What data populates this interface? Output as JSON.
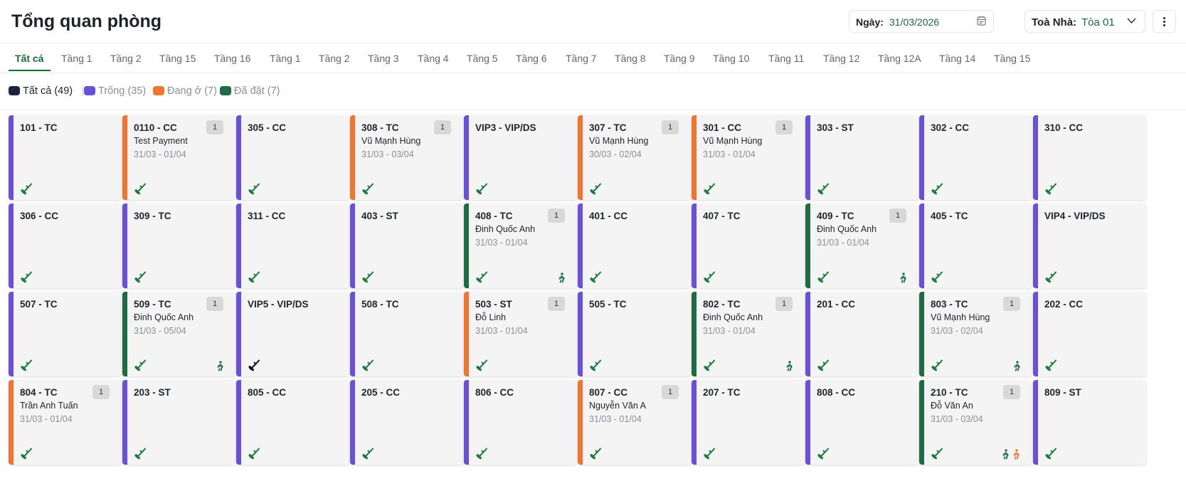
{
  "header": {
    "title": "Tổng quan phòng",
    "date_label": "Ngày:",
    "date_value": "31/03/2026",
    "building_label": "Toà Nhà:",
    "building_value": "Tòa 01"
  },
  "tabs": [
    "Tất cả",
    "Tầng 1",
    "Tầng 2",
    "Tầng 15",
    "Tầng 16",
    "Tầng 1",
    "Tầng 2",
    "Tầng 3",
    "Tầng 4",
    "Tầng 5",
    "Tầng 6",
    "Tầng 7",
    "Tầng 8",
    "Tầng 9",
    "Tầng 10",
    "Tầng 11",
    "Tầng 12",
    "Tầng 12A",
    "Tầng 14",
    "Tầng 15"
  ],
  "active_tab": "Tất cả",
  "filters": [
    {
      "label": "Tất cả (49)",
      "color": "#1c2340",
      "text_color": "#1f2328"
    },
    {
      "label": "Trống (35)",
      "color": "#6a4fd8",
      "text_color": "#8a8f96"
    },
    {
      "label": "Đang ở (7)",
      "color": "#ef7530",
      "text_color": "#8a8f96"
    },
    {
      "label": "Đã đặt (7)",
      "color": "#1f6b45",
      "text_color": "#8a8f96"
    }
  ],
  "colors": {
    "empty": "#6a4fd8",
    "occupied": "#ef7530",
    "booked": "#1f6b45",
    "accent": "#1b6b3a",
    "clean_icon": "#1b7a3e",
    "dirty_icon": "#111111"
  },
  "icons": {
    "calendar": "calendar-icon",
    "chevron": "chevron-down-icon",
    "more": "more-vertical-icon",
    "clean": "broom-check-icon",
    "walk_in": "walking-person-icon",
    "walk_out": "running-person-icon"
  },
  "rooms": [
    {
      "room": "101 - TC",
      "status": "empty"
    },
    {
      "room": "0110 - CC",
      "status": "occupied",
      "guest": "Test Payment",
      "dates": "31/03 - 01/04",
      "badge": "1"
    },
    {
      "room": "305 - CC",
      "status": "empty"
    },
    {
      "room": "308 - TC",
      "status": "occupied",
      "guest": "Vũ Mạnh Hùng",
      "dates": "31/03 - 03/04",
      "badge": "1"
    },
    {
      "room": "VIP3 - VIP/DS",
      "status": "empty"
    },
    {
      "room": "307 - TC",
      "status": "occupied",
      "guest": "Vũ Mạnh Hùng",
      "dates": "30/03 - 02/04",
      "badge": "1"
    },
    {
      "room": "301 - CC",
      "status": "occupied",
      "guest": "Vũ Mạnh Hùng",
      "dates": "31/03 - 01/04",
      "badge": "1"
    },
    {
      "room": "303 - ST",
      "status": "empty"
    },
    {
      "room": "302 - CC",
      "status": "empty"
    },
    {
      "room": "310 - CC",
      "status": "empty"
    },
    {
      "room": "306 - CC",
      "status": "empty"
    },
    {
      "room": "309 - TC",
      "status": "empty"
    },
    {
      "room": "311 - CC",
      "status": "empty"
    },
    {
      "room": "403 - ST",
      "status": "empty"
    },
    {
      "room": "408 - TC",
      "status": "booked",
      "guest": "Đinh Quốc Anh",
      "dates": "31/03 - 01/04",
      "badge": "1",
      "walk": [
        "in"
      ]
    },
    {
      "room": "401 - CC",
      "status": "empty"
    },
    {
      "room": "407 - TC",
      "status": "empty"
    },
    {
      "room": "409 - TC",
      "status": "booked",
      "guest": "Đinh Quốc Anh",
      "dates": "31/03 - 01/04",
      "badge": "1",
      "walk": [
        "in"
      ]
    },
    {
      "room": "405 - TC",
      "status": "empty"
    },
    {
      "room": "VIP4 - VIP/DS",
      "status": "empty"
    },
    {
      "room": "507 - TC",
      "status": "empty"
    },
    {
      "room": "509 - TC",
      "status": "booked",
      "guest": "Đinh Quốc Anh",
      "dates": "31/03 - 05/04",
      "badge": "1",
      "walk": [
        "in"
      ]
    },
    {
      "room": "VIP5 - VIP/DS",
      "status": "empty",
      "dirty": true
    },
    {
      "room": "508 - TC",
      "status": "empty"
    },
    {
      "room": "503 - ST",
      "status": "occupied",
      "guest": "Đỗ Linh",
      "dates": "31/03 - 01/04",
      "badge": "1"
    },
    {
      "room": "505 - TC",
      "status": "empty"
    },
    {
      "room": "802 - TC",
      "status": "booked",
      "guest": "Đinh Quốc Anh",
      "dates": "31/03 - 01/04",
      "badge": "1",
      "walk": [
        "in"
      ]
    },
    {
      "room": "201 - CC",
      "status": "empty"
    },
    {
      "room": "803 - TC",
      "status": "booked",
      "guest": "Vũ Mạnh Hùng",
      "dates": "31/03 - 02/04",
      "badge": "1",
      "walk": [
        "in"
      ]
    },
    {
      "room": "202 - CC",
      "status": "empty"
    },
    {
      "room": "804 - TC",
      "status": "occupied",
      "guest": "Trần Anh Tuấn",
      "dates": "31/03 - 01/04",
      "badge": "1"
    },
    {
      "room": "203 - ST",
      "status": "empty"
    },
    {
      "room": "805 - CC",
      "status": "empty"
    },
    {
      "room": "205 - CC",
      "status": "empty"
    },
    {
      "room": "806 - CC",
      "status": "empty"
    },
    {
      "room": "807 - CC",
      "status": "occupied",
      "guest": "Nguyễn Văn A",
      "dates": "31/03 - 01/04",
      "badge": "1"
    },
    {
      "room": "207 - TC",
      "status": "empty"
    },
    {
      "room": "808 - CC",
      "status": "empty"
    },
    {
      "room": "210 - TC",
      "status": "booked",
      "guest": "Đỗ Văn An",
      "dates": "31/03 - 03/04",
      "badge": "1",
      "walk": [
        "in",
        "out"
      ]
    },
    {
      "room": "809 - ST",
      "status": "empty"
    }
  ]
}
